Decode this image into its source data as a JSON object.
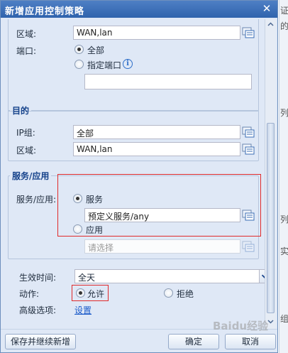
{
  "dialog": {
    "title": "新增应用控制策略",
    "close_glyph": "✕"
  },
  "source": {
    "zone_label": "区域:",
    "zone_value": "WAN,lan",
    "port_label": "端口:",
    "port_all": "全部",
    "port_specified": "指定端口",
    "info_glyph": "i"
  },
  "destination": {
    "legend": "目的",
    "ip_group_label": "IP组:",
    "ip_group_value": "全部",
    "zone_label": "区域:",
    "zone_value": "WAN,lan"
  },
  "service": {
    "legend": "服务/应用",
    "label": "服务/应用:",
    "service_option": "服务",
    "service_value": "预定义服务/any",
    "app_option": "应用",
    "app_placeholder": "请选择"
  },
  "settings": {
    "effective_time_label": "生效时间:",
    "effective_time_value": "全天",
    "action_label": "动作:",
    "allow": "允许",
    "deny": "拒绝",
    "advanced_label": "高级选项:",
    "advanced_link": "设置"
  },
  "footer": {
    "save_continue": "保存并继续新增",
    "ok": "确定",
    "cancel": "取消"
  },
  "side_strip": [
    "证",
    "的",
    "列",
    "列",
    "实",
    "组"
  ],
  "watermark": "Baidu经验"
}
